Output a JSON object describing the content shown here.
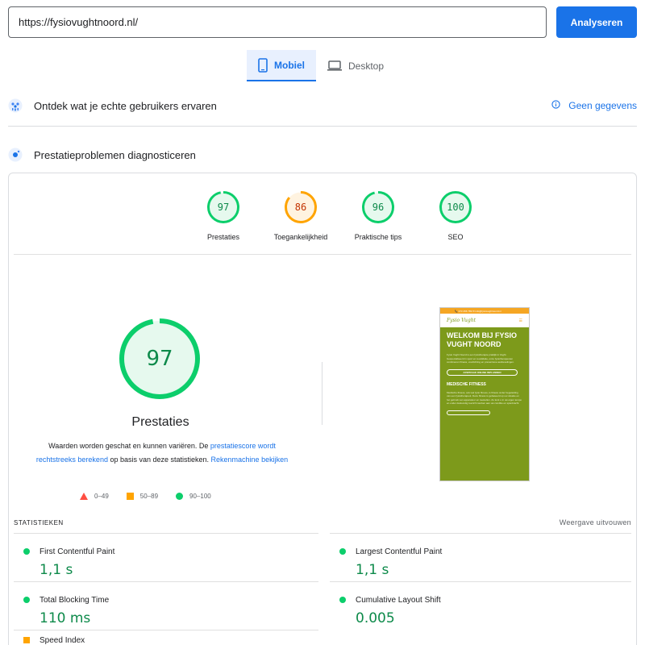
{
  "search": {
    "url": "https://fysiovughtnoord.nl/",
    "button_label": "Analyseren"
  },
  "device_tabs": [
    {
      "label": "Mobiel",
      "active": true
    },
    {
      "label": "Desktop",
      "active": false
    }
  ],
  "field_data": {
    "title": "Ontdek wat je echte gebruikers ervaren",
    "status": "Geen gegevens"
  },
  "lab_data": {
    "title": "Prestatieproblemen diagnosticeren"
  },
  "categories": [
    {
      "label": "Prestaties",
      "score": "97",
      "color": "#0cce6b",
      "text_color": "#0d8a4a",
      "bg": "#e6f9ee",
      "fraction": 0.97
    },
    {
      "label": "Toegankelijkheid",
      "score": "86",
      "color": "#ffa400",
      "text_color": "#c33300",
      "bg": "#fff3e0",
      "fraction": 0.86
    },
    {
      "label": "Praktische tips",
      "score": "96",
      "color": "#0cce6b",
      "text_color": "#0d8a4a",
      "bg": "#e6f9ee",
      "fraction": 0.96
    },
    {
      "label": "SEO",
      "score": "100",
      "color": "#0cce6b",
      "text_color": "#0d8a4a",
      "bg": "#e6f9ee",
      "fraction": 1.0
    }
  ],
  "performance": {
    "score": "97",
    "fraction": 0.97,
    "title": "Prestaties",
    "desc_prefix": "Waarden worden geschat en kunnen variëren. De ",
    "desc_link1": "prestatiescore wordt rechtstreeks berekend",
    "desc_middle": " op basis van deze statistieken. ",
    "desc_link2": "Rekenmachine bekijken",
    "legend": [
      {
        "shape": "triangle",
        "color": "#ff4e42",
        "label": "0–49"
      },
      {
        "shape": "square",
        "color": "#ffa400",
        "label": "50–89"
      },
      {
        "shape": "circle",
        "color": "#0cce6b",
        "label": "90–100"
      }
    ]
  },
  "screenshot": {
    "topbar": "📞 073 456 789   ✉ info@fysiovughtnoord.nl",
    "logo": "Fysio Vught",
    "heading": "WELKOM BIJ FYSIO VUGHT NOORD",
    "text": "Fysio Vught Noord is een fysiotherapie praktijk in Vught. Gespecialiseerd in sport en revalidatie, onze fysiotherapeuten combineren fitness, voorlichting en preventieve aanbevelingen.",
    "button": "AFSPRAAK ONLINE INPLANNEN",
    "subheading": "MEDISCHE FITNESS",
    "subtext": "Medische fitness, ook wel fysio fitness, is fitness onder begeleiding van een fysiotherapeut. Deze fitness is gebaseerd op uw situatie en het gebruik van apparatuur en toestellen. Zo kunt u in uw eigen tempo en onder deskundig toezicht werken aan uw conditie en spierkracht."
  },
  "stats": {
    "title": "STATISTIEKEN",
    "expand": "Weergave uitvouwen",
    "metrics": [
      {
        "name": "First Contentful Paint",
        "value": "1,1 s",
        "status": "good"
      },
      {
        "name": "Largest Contentful Paint",
        "value": "1,1 s",
        "status": "good"
      },
      {
        "name": "Total Blocking Time",
        "value": "110 ms",
        "status": "good"
      },
      {
        "name": "Cumulative Layout Shift",
        "value": "0.005",
        "status": "good"
      },
      {
        "name": "Speed Index",
        "value": "",
        "status": "average"
      }
    ]
  }
}
